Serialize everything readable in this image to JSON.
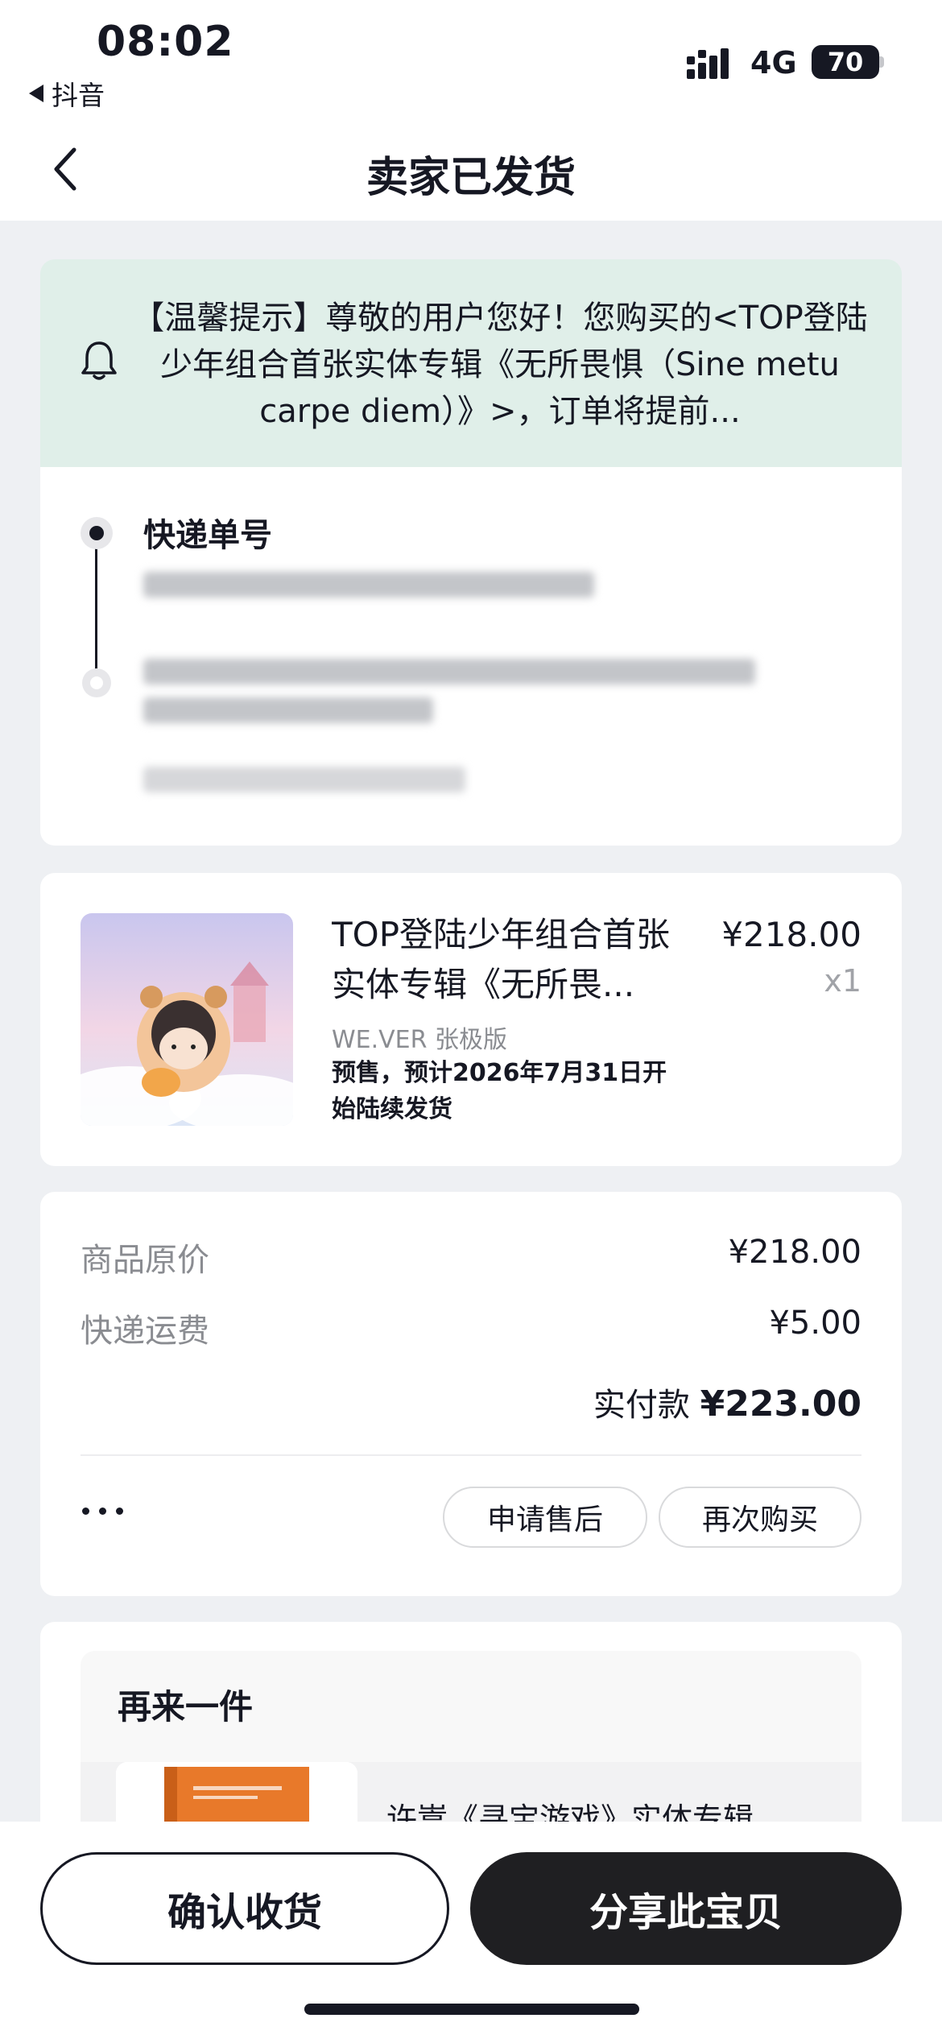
{
  "status_bar": {
    "time": "08:02",
    "back_app": "抖音",
    "network": "4G",
    "battery": "70"
  },
  "header": {
    "title": "卖家已发货"
  },
  "notice": {
    "text": "【温馨提示】尊敬的用户您好！您购买的<TOP登陆少年组合首张实体专辑《无所畏惧（Sine metu carpe diem）》>，订单将提前..."
  },
  "logistics": {
    "title": "快递单号"
  },
  "product": {
    "name": "TOP登陆少年组合首张实体专辑《无所畏...",
    "price": "¥218.00",
    "quantity": "x1",
    "sku": "WE.VER 张极版",
    "presale_note": "预售，预计2026年7月31日开始陆续发货"
  },
  "payment": {
    "original_price_label": "商品原价",
    "original_price_value": "¥218.00",
    "shipping_label": "快递运费",
    "shipping_value": "¥5.00",
    "total_label": "实付款",
    "total_value": "¥223.00",
    "after_sale_button": "申请售后",
    "buy_again_button": "再次购买"
  },
  "buy_again": {
    "title": "再来一件",
    "item_name": "许嵩《寻宝游戏》实体专辑"
  },
  "bottom_bar": {
    "confirm_button": "确认收货",
    "share_button": "分享此宝贝"
  }
}
